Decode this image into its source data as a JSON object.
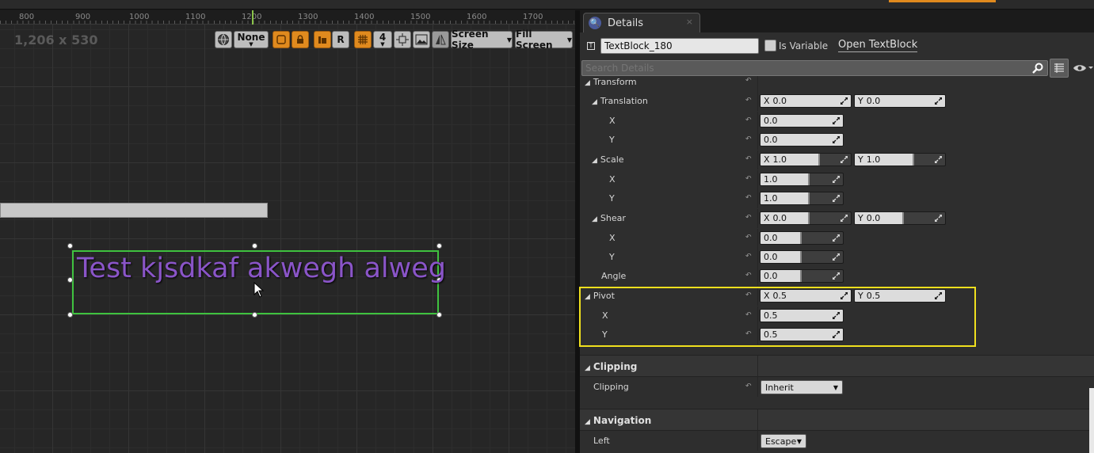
{
  "viewport": {
    "ruler_ticks": [
      "800",
      "900",
      "1000",
      "1100",
      "1200",
      "1300",
      "1400",
      "1500",
      "1600",
      "1700"
    ],
    "resolution": "1,206 x 530",
    "toolbar": {
      "none_label": "None",
      "r_label": "R",
      "grid_snap": "4",
      "screen_size_label": "Screen Size",
      "fill_screen_label": "Fill Screen"
    },
    "text_block_text": "Test kjsdkaf akwegh alweg"
  },
  "details": {
    "tab_label": "Details",
    "tab_close": "×",
    "widget_name": "TextBlock_180",
    "is_variable_label": "Is Variable",
    "open_textblock_label": "Open TextBlock",
    "search_placeholder": "Search Details",
    "transform": {
      "label": "Transform",
      "translation": {
        "label": "Translation",
        "x_axis": "X",
        "x": "0.0",
        "y_axis": "Y",
        "y": "0.0",
        "x_label": "X",
        "y_label": "Y"
      },
      "scale": {
        "label": "Scale",
        "x_axis": "X",
        "x": "1.0",
        "y_axis": "Y",
        "y": "1.0",
        "x_label": "X",
        "y_label": "Y"
      },
      "shear": {
        "label": "Shear",
        "x_axis": "X",
        "x": "0.0",
        "y_axis": "Y",
        "y": "0.0",
        "x_label": "X",
        "y_label": "Y"
      },
      "angle": {
        "label": "Angle",
        "value": "0.0"
      },
      "pivot": {
        "label": "Pivot",
        "x_axis": "X",
        "x": "0.5",
        "y_axis": "Y",
        "y": "0.5",
        "x_label": "X",
        "y_label": "Y"
      }
    },
    "clipping": {
      "section": "Clipping",
      "label": "Clipping",
      "value": "Inherit"
    },
    "navigation": {
      "section": "Navigation",
      "left_label": "Left",
      "left_value": "Escape"
    }
  },
  "colors": {
    "accent_orange": "#e08a1e",
    "selection_green": "#3fc23f",
    "text_purple": "#8a55c8",
    "highlight_yellow": "#f0e01e"
  }
}
